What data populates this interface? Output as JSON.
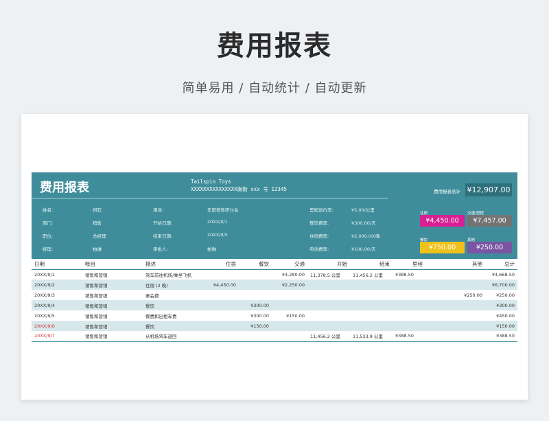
{
  "hero": {
    "title": "费用报表",
    "subtitle": "简单易用  /  自动统计  /  自动更新"
  },
  "report": {
    "title": "费用报表",
    "company": "Tailspin Toys",
    "address": "XXXXXXXXXXXXXXX南街 xxx 号 12345",
    "info": [
      {
        "label": "姓名:",
        "value": "何石"
      },
      {
        "label": "部门:",
        "value": "销售"
      },
      {
        "label": "职位:",
        "value": "总经理"
      },
      {
        "label": "经理:",
        "value": "柏琳"
      }
    ],
    "info2": [
      {
        "label": "用途:",
        "value": "年度销售研讨会"
      },
      {
        "label": "开始日期:",
        "value": "20XX/9/1"
      },
      {
        "label": "结束日期:",
        "value": "20XX/9/5"
      },
      {
        "label": "审批人:",
        "value": "柏琳"
      }
    ],
    "rates": [
      {
        "label": "里程运价率:",
        "value": "¥5.00/公里"
      },
      {
        "label": "餐饮费率:",
        "value": "¥300.00/天"
      },
      {
        "label": "住宿费率:",
        "value": "¥2,000.00/晚"
      },
      {
        "label": "电话费率:",
        "value": "¥100.00/天"
      }
    ],
    "total_label": "费用报表总计",
    "total_value": "¥12,907.00",
    "tiles": [
      {
        "label": "住宿",
        "value": "¥4,450.00",
        "color": "#d81f93"
      },
      {
        "label": "交通/里程",
        "value": "¥7,457.00",
        "color": "#737373"
      },
      {
        "label": "餐饮",
        "value": "¥750.00",
        "color": "#efc11a"
      },
      {
        "label": "其他",
        "value": "¥250.00",
        "color": "#7a55a3"
      }
    ]
  },
  "table": {
    "headers": [
      "日期",
      "帐目",
      "描述",
      "住宿",
      "餐饮",
      "交通",
      "开始",
      "结束",
      "里程",
      "其他",
      "总计"
    ],
    "rows": [
      [
        "20XX/9/1",
        "销售和营销",
        "驾车前往机场/乘坐飞机",
        "",
        "",
        "¥4,280.00",
        "11,378.5 公里",
        "11,456.2 公里",
        "¥388.50",
        "",
        "¥4,668.50"
      ],
      [
        "20XX/9/2",
        "销售和营销",
        "住宿 (2 晚)",
        "¥4,450.00",
        "",
        "¥2,250.00",
        "",
        "",
        "",
        "",
        "¥6,700.00"
      ],
      [
        "20XX/9/3",
        "销售和营销",
        "参会费",
        "",
        "",
        "",
        "",
        "",
        "",
        "¥250.00",
        "¥250.00"
      ],
      [
        "20XX/9/4",
        "销售和营销",
        "餐饮",
        "",
        "¥300.00",
        "",
        "",
        "",
        "",
        "",
        "¥300.00"
      ],
      [
        "20XX/9/5",
        "销售和营销",
        "餐费和出租车费",
        "",
        "¥300.00",
        "¥150.00",
        "",
        "",
        "",
        "",
        "¥450.00"
      ],
      [
        "20XX/9/6",
        "销售和营销",
        "餐饮",
        "",
        "¥150.00",
        "",
        "",
        "",
        "",
        "",
        "¥150.00"
      ],
      [
        "20XX/9/7",
        "销售和营销",
        "从机场驾车返回",
        "",
        "",
        "",
        "11,456.2 公里",
        "11,533.9 公里",
        "¥388.50",
        "",
        "¥388.50"
      ]
    ]
  }
}
